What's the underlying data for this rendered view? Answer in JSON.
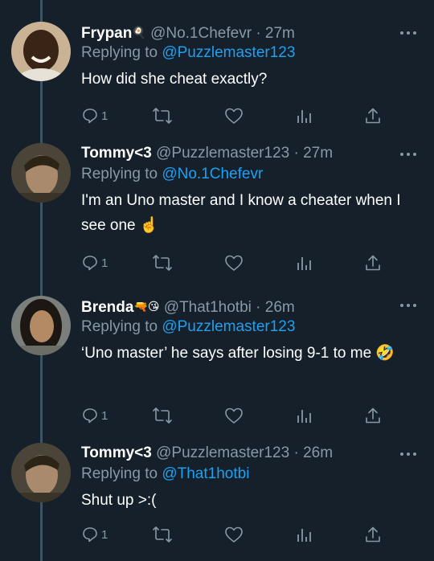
{
  "tweets": [
    {
      "name": "Frypan",
      "name_emoji": "🍳",
      "handle": "@No.1Chefevr",
      "time": "27m",
      "reply_prefix": "Replying to",
      "reply_mention": "@Puzzlemaster123",
      "text": "How did she cheat exactly?",
      "reply_count": "1"
    },
    {
      "name": "Tommy<3",
      "name_emoji": "",
      "handle": "@Puzzlemaster123",
      "time": "27m",
      "reply_prefix": "Replying to",
      "reply_mention": "@No.1Chefevr",
      "text": "I'm an Uno master and I know a cheater when I see one ☝️",
      "reply_count": "1"
    },
    {
      "name": "Brenda",
      "name_emoji": "🔫😘",
      "handle": "@That1hotbi",
      "time": "26m",
      "reply_prefix": "Replying to",
      "reply_mention": "@Puzzlemaster123",
      "text": "‘Uno master’ he says after losing 9-1 to me 🤣",
      "reply_count": "1"
    },
    {
      "name": "Tommy<3",
      "name_emoji": "",
      "handle": "@Puzzlemaster123",
      "time": "26m",
      "reply_prefix": "Replying to",
      "reply_mention": "@That1hotbi",
      "text": "Shut up >:(",
      "reply_count": "1"
    }
  ],
  "separator": "·",
  "colors": {
    "background": "#15202b",
    "text": "#ffffff",
    "muted": "#8899a6",
    "link": "#1da1f2",
    "thread_line": "#3d5466"
  },
  "icons": [
    "reply-icon",
    "retweet-icon",
    "like-icon",
    "analytics-icon",
    "share-icon",
    "more-icon"
  ]
}
